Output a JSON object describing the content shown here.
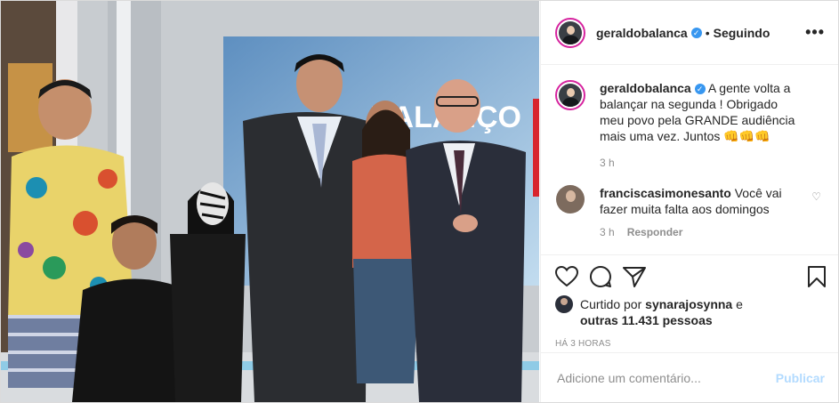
{
  "post": {
    "username": "geraldobalanca",
    "follow_status": "Seguindo",
    "more_label": "•••",
    "caption": "A gente volta a balançar na segunda ! Obrigado meu povo pela GRANDE audiência mais uma vez. Juntos 👊👊👊",
    "caption_time": "3 h",
    "photo_sign_text": "BALANÇO",
    "comments": [
      {
        "username": "franciscasimonesanto",
        "text": "Você vai fazer muita falta aos domingos",
        "time": "3 h",
        "reply_label": "Responder"
      }
    ],
    "likes": {
      "prefix": "Curtido por",
      "user": "synarajosynna",
      "connector": "e",
      "others": "outras 11.431 pessoas"
    },
    "posted_ago": "HÁ 3 HORAS",
    "comment_input": {
      "placeholder": "Adicione um comentário...",
      "value": ""
    },
    "publish_label": "Publicar"
  },
  "colors": {
    "accent": "#3897f0",
    "publish_disabled": "#b3dbff",
    "muted": "#8e8e8e",
    "border": "#efefef"
  }
}
